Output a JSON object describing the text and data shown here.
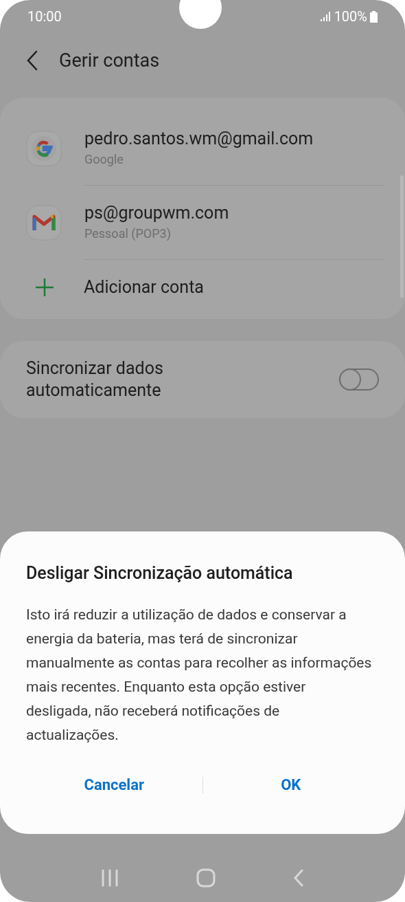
{
  "status_bar": {
    "time": "10:00",
    "battery": "100%"
  },
  "header": {
    "title": "Gerir contas"
  },
  "accounts": [
    {
      "kind": "google",
      "email": "pedro.santos.wm@gmail.com",
      "type": "Google"
    },
    {
      "kind": "gmail",
      "email": "ps@groupwm.com",
      "type": "Pessoal (POP3)"
    }
  ],
  "add_account": {
    "label": "Adicionar conta"
  },
  "sync": {
    "label": "Sincronizar dados automaticamente",
    "on": false
  },
  "dialog": {
    "title": "Desligar Sincronização automática",
    "message": "Isto irá reduzir a utilização de dados e conservar a energia da bateria, mas terá de sincronizar manualmente as contas para recolher as informações mais recentes. Enquanto esta opção estiver desligada, não receberá notificações de actualizações.",
    "buttons": [
      "Cancelar",
      "OK"
    ]
  }
}
